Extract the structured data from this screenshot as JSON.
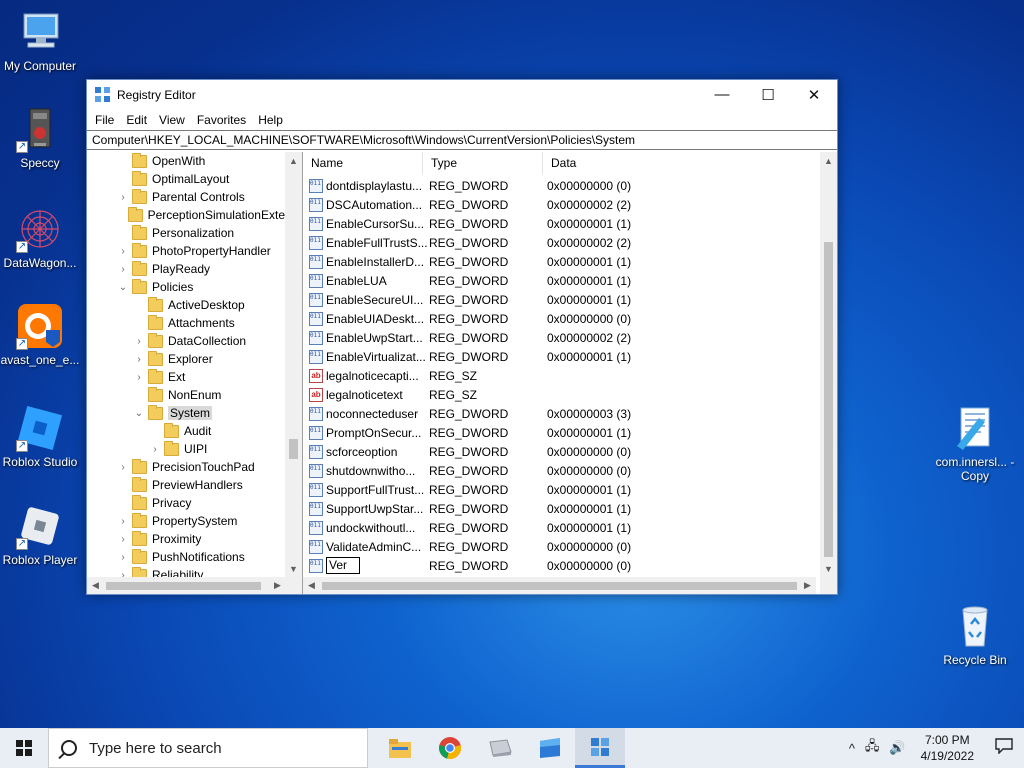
{
  "desktop": {
    "icons_left": [
      {
        "label": "My Computer",
        "icon": "my-computer-icon"
      },
      {
        "label": "Speccy",
        "icon": "speccy-icon"
      },
      {
        "label": "DataWagon...",
        "icon": "datawagon-icon"
      },
      {
        "label": "avast_one_e...",
        "icon": "avast-icon"
      },
      {
        "label": "Roblox Studio",
        "icon": "roblox-studio-icon"
      },
      {
        "label": "Roblox Player",
        "icon": "roblox-player-icon"
      }
    ],
    "icon_file": {
      "label": "com.innersl... - Copy",
      "icon": "text-file-icon"
    },
    "icon_recycle": {
      "label": "Recycle Bin",
      "icon": "recycle-bin-icon"
    }
  },
  "window": {
    "title": "Registry Editor",
    "controls": {
      "minimize": "—",
      "maximize": "☐",
      "close": "✕"
    },
    "menu": [
      "File",
      "Edit",
      "View",
      "Favorites",
      "Help"
    ],
    "address": "Computer\\HKEY_LOCAL_MACHINE\\SOFTWARE\\Microsoft\\Windows\\CurrentVersion\\Policies\\System",
    "tree": [
      {
        "label": "OpenWith",
        "level": 0,
        "chevron": ""
      },
      {
        "label": "OptimalLayout",
        "level": 0,
        "chevron": ""
      },
      {
        "label": "Parental Controls",
        "level": 0,
        "chevron": ">"
      },
      {
        "label": "PerceptionSimulationExte",
        "level": 0,
        "chevron": ""
      },
      {
        "label": "Personalization",
        "level": 0,
        "chevron": ""
      },
      {
        "label": "PhotoPropertyHandler",
        "level": 0,
        "chevron": ">"
      },
      {
        "label": "PlayReady",
        "level": 0,
        "chevron": ">"
      },
      {
        "label": "Policies",
        "level": 0,
        "chevron": "v"
      },
      {
        "label": "ActiveDesktop",
        "level": 1,
        "chevron": ""
      },
      {
        "label": "Attachments",
        "level": 1,
        "chevron": ""
      },
      {
        "label": "DataCollection",
        "level": 1,
        "chevron": ">"
      },
      {
        "label": "Explorer",
        "level": 1,
        "chevron": ">"
      },
      {
        "label": "Ext",
        "level": 1,
        "chevron": ">"
      },
      {
        "label": "NonEnum",
        "level": 1,
        "chevron": ""
      },
      {
        "label": "System",
        "level": 1,
        "chevron": "v",
        "selected": true
      },
      {
        "label": "Audit",
        "level": 2,
        "chevron": ""
      },
      {
        "label": "UIPI",
        "level": 2,
        "chevron": ">"
      },
      {
        "label": "PrecisionTouchPad",
        "level": 0,
        "chevron": ">"
      },
      {
        "label": "PreviewHandlers",
        "level": 0,
        "chevron": ""
      },
      {
        "label": "Privacy",
        "level": 0,
        "chevron": ""
      },
      {
        "label": "PropertySystem",
        "level": 0,
        "chevron": ">"
      },
      {
        "label": "Proximity",
        "level": 0,
        "chevron": ">"
      },
      {
        "label": "PushNotifications",
        "level": 0,
        "chevron": ">"
      },
      {
        "label": "Reliability",
        "level": 0,
        "chevron": ">"
      }
    ],
    "columns": {
      "name": "Name",
      "type": "Type",
      "data": "Data"
    },
    "values": [
      {
        "name": "dontdisplaylastu...",
        "type": "REG_DWORD",
        "data": "0x00000000 (0)",
        "kind": "bin"
      },
      {
        "name": "DSCAutomation...",
        "type": "REG_DWORD",
        "data": "0x00000002 (2)",
        "kind": "bin"
      },
      {
        "name": "EnableCursorSu...",
        "type": "REG_DWORD",
        "data": "0x00000001 (1)",
        "kind": "bin"
      },
      {
        "name": "EnableFullTrustS...",
        "type": "REG_DWORD",
        "data": "0x00000002 (2)",
        "kind": "bin"
      },
      {
        "name": "EnableInstallerD...",
        "type": "REG_DWORD",
        "data": "0x00000001 (1)",
        "kind": "bin"
      },
      {
        "name": "EnableLUA",
        "type": "REG_DWORD",
        "data": "0x00000001 (1)",
        "kind": "bin"
      },
      {
        "name": "EnableSecureUI...",
        "type": "REG_DWORD",
        "data": "0x00000001 (1)",
        "kind": "bin"
      },
      {
        "name": "EnableUIADeskt...",
        "type": "REG_DWORD",
        "data": "0x00000000 (0)",
        "kind": "bin"
      },
      {
        "name": "EnableUwpStart...",
        "type": "REG_DWORD",
        "data": "0x00000002 (2)",
        "kind": "bin"
      },
      {
        "name": "EnableVirtualizat...",
        "type": "REG_DWORD",
        "data": "0x00000001 (1)",
        "kind": "bin"
      },
      {
        "name": "legalnoticecapti...",
        "type": "REG_SZ",
        "data": "",
        "kind": "sz"
      },
      {
        "name": "legalnoticetext",
        "type": "REG_SZ",
        "data": "",
        "kind": "sz"
      },
      {
        "name": "noconnecteduser",
        "type": "REG_DWORD",
        "data": "0x00000003 (3)",
        "kind": "bin"
      },
      {
        "name": "PromptOnSecur...",
        "type": "REG_DWORD",
        "data": "0x00000001 (1)",
        "kind": "bin"
      },
      {
        "name": "scforceoption",
        "type": "REG_DWORD",
        "data": "0x00000000 (0)",
        "kind": "bin"
      },
      {
        "name": "shutdownwitho...",
        "type": "REG_DWORD",
        "data": "0x00000000 (0)",
        "kind": "bin"
      },
      {
        "name": "SupportFullTrust...",
        "type": "REG_DWORD",
        "data": "0x00000001 (1)",
        "kind": "bin"
      },
      {
        "name": "SupportUwpStar...",
        "type": "REG_DWORD",
        "data": "0x00000001 (1)",
        "kind": "bin"
      },
      {
        "name": "undockwithoutl...",
        "type": "REG_DWORD",
        "data": "0x00000001 (1)",
        "kind": "bin"
      },
      {
        "name": "ValidateAdminC...",
        "type": "REG_DWORD",
        "data": "0x00000000 (0)",
        "kind": "bin"
      },
      {
        "name": "Ver",
        "type": "REG_DWORD",
        "data": "0x00000000 (0)",
        "kind": "bin",
        "editing": true
      }
    ]
  },
  "taskbar": {
    "search_placeholder": "Type here to search",
    "apps": [
      "file-explorer-icon",
      "chrome-icon",
      "drive-icon",
      "microsoft-store-icon",
      "registry-editor-icon"
    ],
    "tray": {
      "chevron": "^",
      "network": "🖧",
      "volume": "🔊"
    },
    "time": "7:00 PM",
    "date": "4/19/2022"
  },
  "colors": {
    "accent": "#3b78d8",
    "folder": "#f3cd5b"
  }
}
